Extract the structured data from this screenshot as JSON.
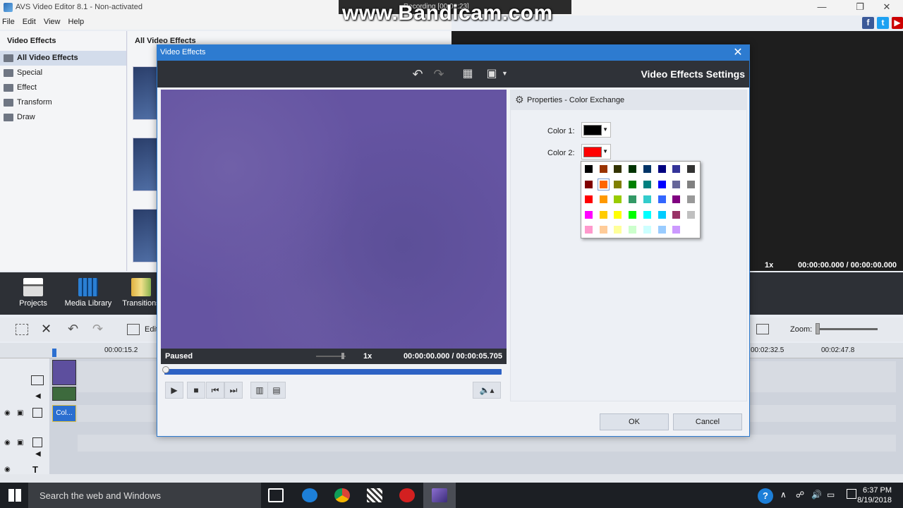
{
  "app": {
    "title": "AVS Video Editor 8.1 - Non-activated",
    "menu": [
      "File",
      "Edit",
      "View",
      "Help"
    ],
    "window_controls": [
      "—",
      "❐",
      "✕"
    ]
  },
  "overlay": {
    "watermark": "www.Bandicam.com",
    "recording": "Recording [00:0▮:23]"
  },
  "left_panel": {
    "header": "Video Effects",
    "items": [
      "All Video Effects",
      "Special",
      "Effect",
      "Transform",
      "Draw"
    ]
  },
  "mid_panel": {
    "header": "All Video Effects"
  },
  "preview": {
    "speed": "1x",
    "time": "00:00:00.000 / 00:00:00.000"
  },
  "toolbar": {
    "items": [
      "Projects",
      "Media Library",
      "Transitions"
    ]
  },
  "timeline": {
    "edit_label": "Edit",
    "zoom_label": "Zoom:",
    "ruler": [
      "00:00:15.2",
      "00:02:32.5",
      "00:02:47.8"
    ],
    "clip_label": "Col..."
  },
  "dialog": {
    "title": "Video Effects",
    "heading": "Video Effects Settings",
    "status": "Paused",
    "speed": "1x",
    "time": "00:00:00.000 / 00:00:05.705",
    "properties_title": "Properties - Color Exchange",
    "color1_label": "Color 1:",
    "color1_value": "#000000",
    "color2_label": "Color 2:",
    "color2_value": "#ff0000",
    "ok": "OK",
    "cancel": "Cancel",
    "palette": [
      [
        "#000000",
        "#993300",
        "#333300",
        "#003300",
        "#003366",
        "#000080",
        "#333399",
        "#333333"
      ],
      [
        "#800000",
        "#ff6600",
        "#808000",
        "#008000",
        "#008080",
        "#0000ff",
        "#666699",
        "#808080"
      ],
      [
        "#ff0000",
        "#ff9900",
        "#99cc00",
        "#339966",
        "#33cccc",
        "#3366ff",
        "#800080",
        "#999999"
      ],
      [
        "#ff00ff",
        "#ffcc00",
        "#ffff00",
        "#00ff00",
        "#00ffff",
        "#00ccff",
        "#993366",
        "#c0c0c0"
      ],
      [
        "#ff99cc",
        "#ffcc99",
        "#ffff99",
        "#ccffcc",
        "#ccffff",
        "#99ccff",
        "#cc99ff",
        "#ffffff"
      ]
    ],
    "palette_highlight": [
      1,
      1
    ]
  },
  "taskbar": {
    "search": "Search the web and Windows",
    "time": "6:37 PM",
    "date": "8/19/2018"
  }
}
